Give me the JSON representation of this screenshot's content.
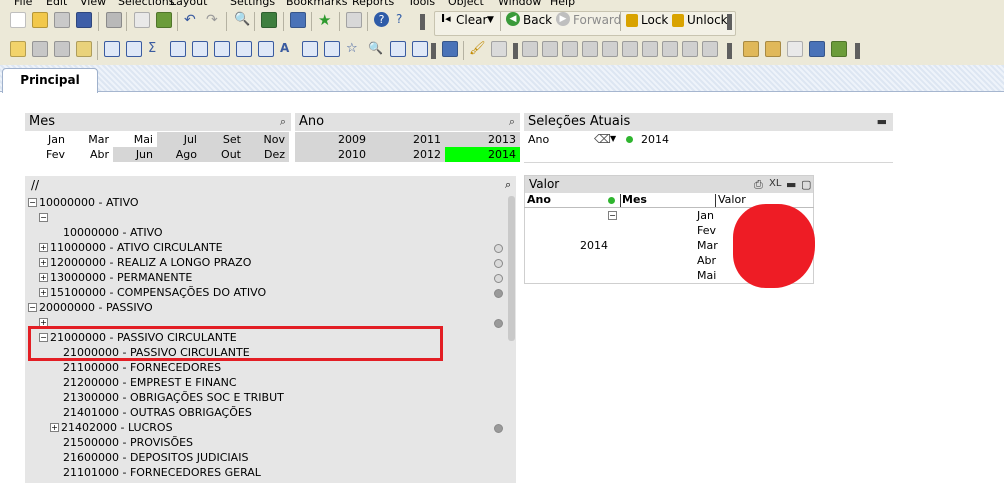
{
  "menu": [
    "File",
    "Edit",
    "View",
    "Selections",
    "Layout",
    "Settings",
    "Bookmarks",
    "Reports",
    "Tools",
    "Object",
    "Window",
    "Help"
  ],
  "toolbar": {
    "clear_label": "Clear",
    "back_label": "Back",
    "forward_label": "Forward",
    "lock_label": "Lock",
    "unlock_label": "Unlock"
  },
  "tabs": [
    {
      "label": "Principal",
      "active": true
    }
  ],
  "mes_box": {
    "title": "Mes",
    "items": [
      {
        "label": "Jan",
        "state": "possible"
      },
      {
        "label": "Mar",
        "state": "possible"
      },
      {
        "label": "Mai",
        "state": "possible"
      },
      {
        "label": "Jul",
        "state": "excluded"
      },
      {
        "label": "Set",
        "state": "excluded"
      },
      {
        "label": "Nov",
        "state": "excluded"
      },
      {
        "label": "Fev",
        "state": "possible"
      },
      {
        "label": "Abr",
        "state": "possible"
      },
      {
        "label": "Jun",
        "state": "excluded"
      },
      {
        "label": "Ago",
        "state": "excluded"
      },
      {
        "label": "Out",
        "state": "excluded"
      },
      {
        "label": "Dez",
        "state": "excluded"
      }
    ]
  },
  "ano_box": {
    "title": "Ano",
    "items": [
      {
        "label": "2009",
        "state": "excluded"
      },
      {
        "label": "2011",
        "state": "excluded"
      },
      {
        "label": "2013",
        "state": "excluded"
      },
      {
        "label": "2010",
        "state": "excluded"
      },
      {
        "label": "2012",
        "state": "excluded"
      },
      {
        "label": "2014",
        "state": "selected"
      }
    ]
  },
  "current_selections": {
    "title": "Seleções Atuais",
    "field": "Ano",
    "value": "2014"
  },
  "tree": {
    "title": "//",
    "rows": [
      {
        "label": "10000000 - ATIVO",
        "indent": 0,
        "toggle": "minus",
        "dot": "none"
      },
      {
        "label": "",
        "indent": 1,
        "toggle": "minus",
        "dot": "none"
      },
      {
        "label": "10000000 - ATIVO",
        "indent": 2,
        "toggle": "none",
        "dot": "none"
      },
      {
        "label": "11000000 - ATIVO CIRCULANTE",
        "indent": 1,
        "toggle": "plus",
        "dot": "empty"
      },
      {
        "label": "12000000 - REALIZ  A LONGO PRAZO",
        "indent": 1,
        "toggle": "plus",
        "dot": "empty"
      },
      {
        "label": "13000000 - PERMANENTE",
        "indent": 1,
        "toggle": "plus",
        "dot": "empty"
      },
      {
        "label": "15100000 - COMPENSAÇÕES DO ATIVO",
        "indent": 1,
        "toggle": "plus",
        "dot": "filled"
      },
      {
        "label": "20000000 - PASSIVO",
        "indent": 0,
        "toggle": "minus",
        "dot": "none"
      },
      {
        "label": "",
        "indent": 1,
        "toggle": "plus",
        "dot": "filled"
      },
      {
        "label": "21000000 - PASSIVO CIRCULANTE",
        "indent": 1,
        "toggle": "minus",
        "dot": "none"
      },
      {
        "label": "21000000 - PASSIVO CIRCULANTE",
        "indent": 2,
        "toggle": "none",
        "dot": "none"
      },
      {
        "label": "21100000 - FORNECEDORES",
        "indent": 2,
        "toggle": "none",
        "dot": "none"
      },
      {
        "label": "21200000 - EMPREST E FINANC",
        "indent": 2,
        "toggle": "none",
        "dot": "none"
      },
      {
        "label": "21300000 - OBRIGAÇÕES SOC E TRIBUT",
        "indent": 2,
        "toggle": "none",
        "dot": "none"
      },
      {
        "label": "21401000 - OUTRAS OBRIGAÇÕES",
        "indent": 2,
        "toggle": "none",
        "dot": "none"
      },
      {
        "label": "21402000 - LUCROS",
        "indent": 2,
        "toggle": "plus",
        "dot": "filled"
      },
      {
        "label": "21500000 - PROVISÕES",
        "indent": 2,
        "toggle": "none",
        "dot": "none"
      },
      {
        "label": "21600000 - DEPOSITOS  JUDICIAIS",
        "indent": 2,
        "toggle": "none",
        "dot": "none"
      },
      {
        "label": "21101000 - FORNECEDORES GERAL",
        "indent": 2,
        "toggle": "none",
        "dot": "none"
      }
    ]
  },
  "pivot": {
    "title": "Valor",
    "xl_label": "XL",
    "headers": {
      "ano": "Ano",
      "mes": "Mes",
      "valor": "Valor"
    },
    "year": "2014",
    "months": [
      "Jan",
      "Fev",
      "Mar",
      "Abr",
      "Mai"
    ]
  },
  "colors": {
    "selected": "#00ff00",
    "excluded": "#d6d6d6",
    "highlight_box": "#e31e24",
    "redacted_blob": "#ee1c25"
  }
}
